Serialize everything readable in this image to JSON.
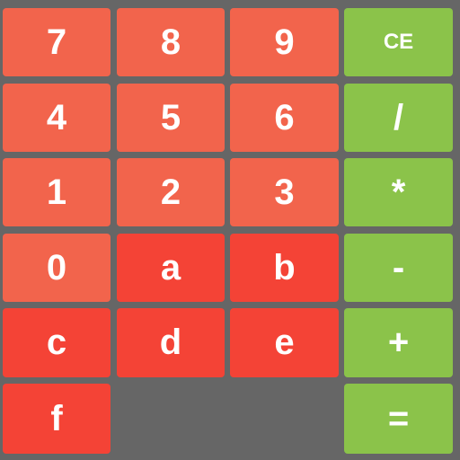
{
  "colors": {
    "digit": "#f2644c",
    "hex": "#f44336",
    "operator": "#8bc34a",
    "background": "#666666"
  },
  "keys": [
    {
      "label": "7",
      "kind": "digit"
    },
    {
      "label": "8",
      "kind": "digit"
    },
    {
      "label": "9",
      "kind": "digit"
    },
    {
      "label": "CE",
      "kind": "operator"
    },
    {
      "label": "4",
      "kind": "digit"
    },
    {
      "label": "5",
      "kind": "digit"
    },
    {
      "label": "6",
      "kind": "digit"
    },
    {
      "label": "/",
      "kind": "operator"
    },
    {
      "label": "1",
      "kind": "digit"
    },
    {
      "label": "2",
      "kind": "digit"
    },
    {
      "label": "3",
      "kind": "digit"
    },
    {
      "label": "*",
      "kind": "operator"
    },
    {
      "label": "0",
      "kind": "digit"
    },
    {
      "label": "a",
      "kind": "hex"
    },
    {
      "label": "b",
      "kind": "hex"
    },
    {
      "label": "-",
      "kind": "operator"
    },
    {
      "label": "c",
      "kind": "hex"
    },
    {
      "label": "d",
      "kind": "hex"
    },
    {
      "label": "e",
      "kind": "hex"
    },
    {
      "label": "+",
      "kind": "operator"
    },
    {
      "label": "f",
      "kind": "hex"
    },
    {
      "label": "=",
      "kind": "operator"
    }
  ]
}
